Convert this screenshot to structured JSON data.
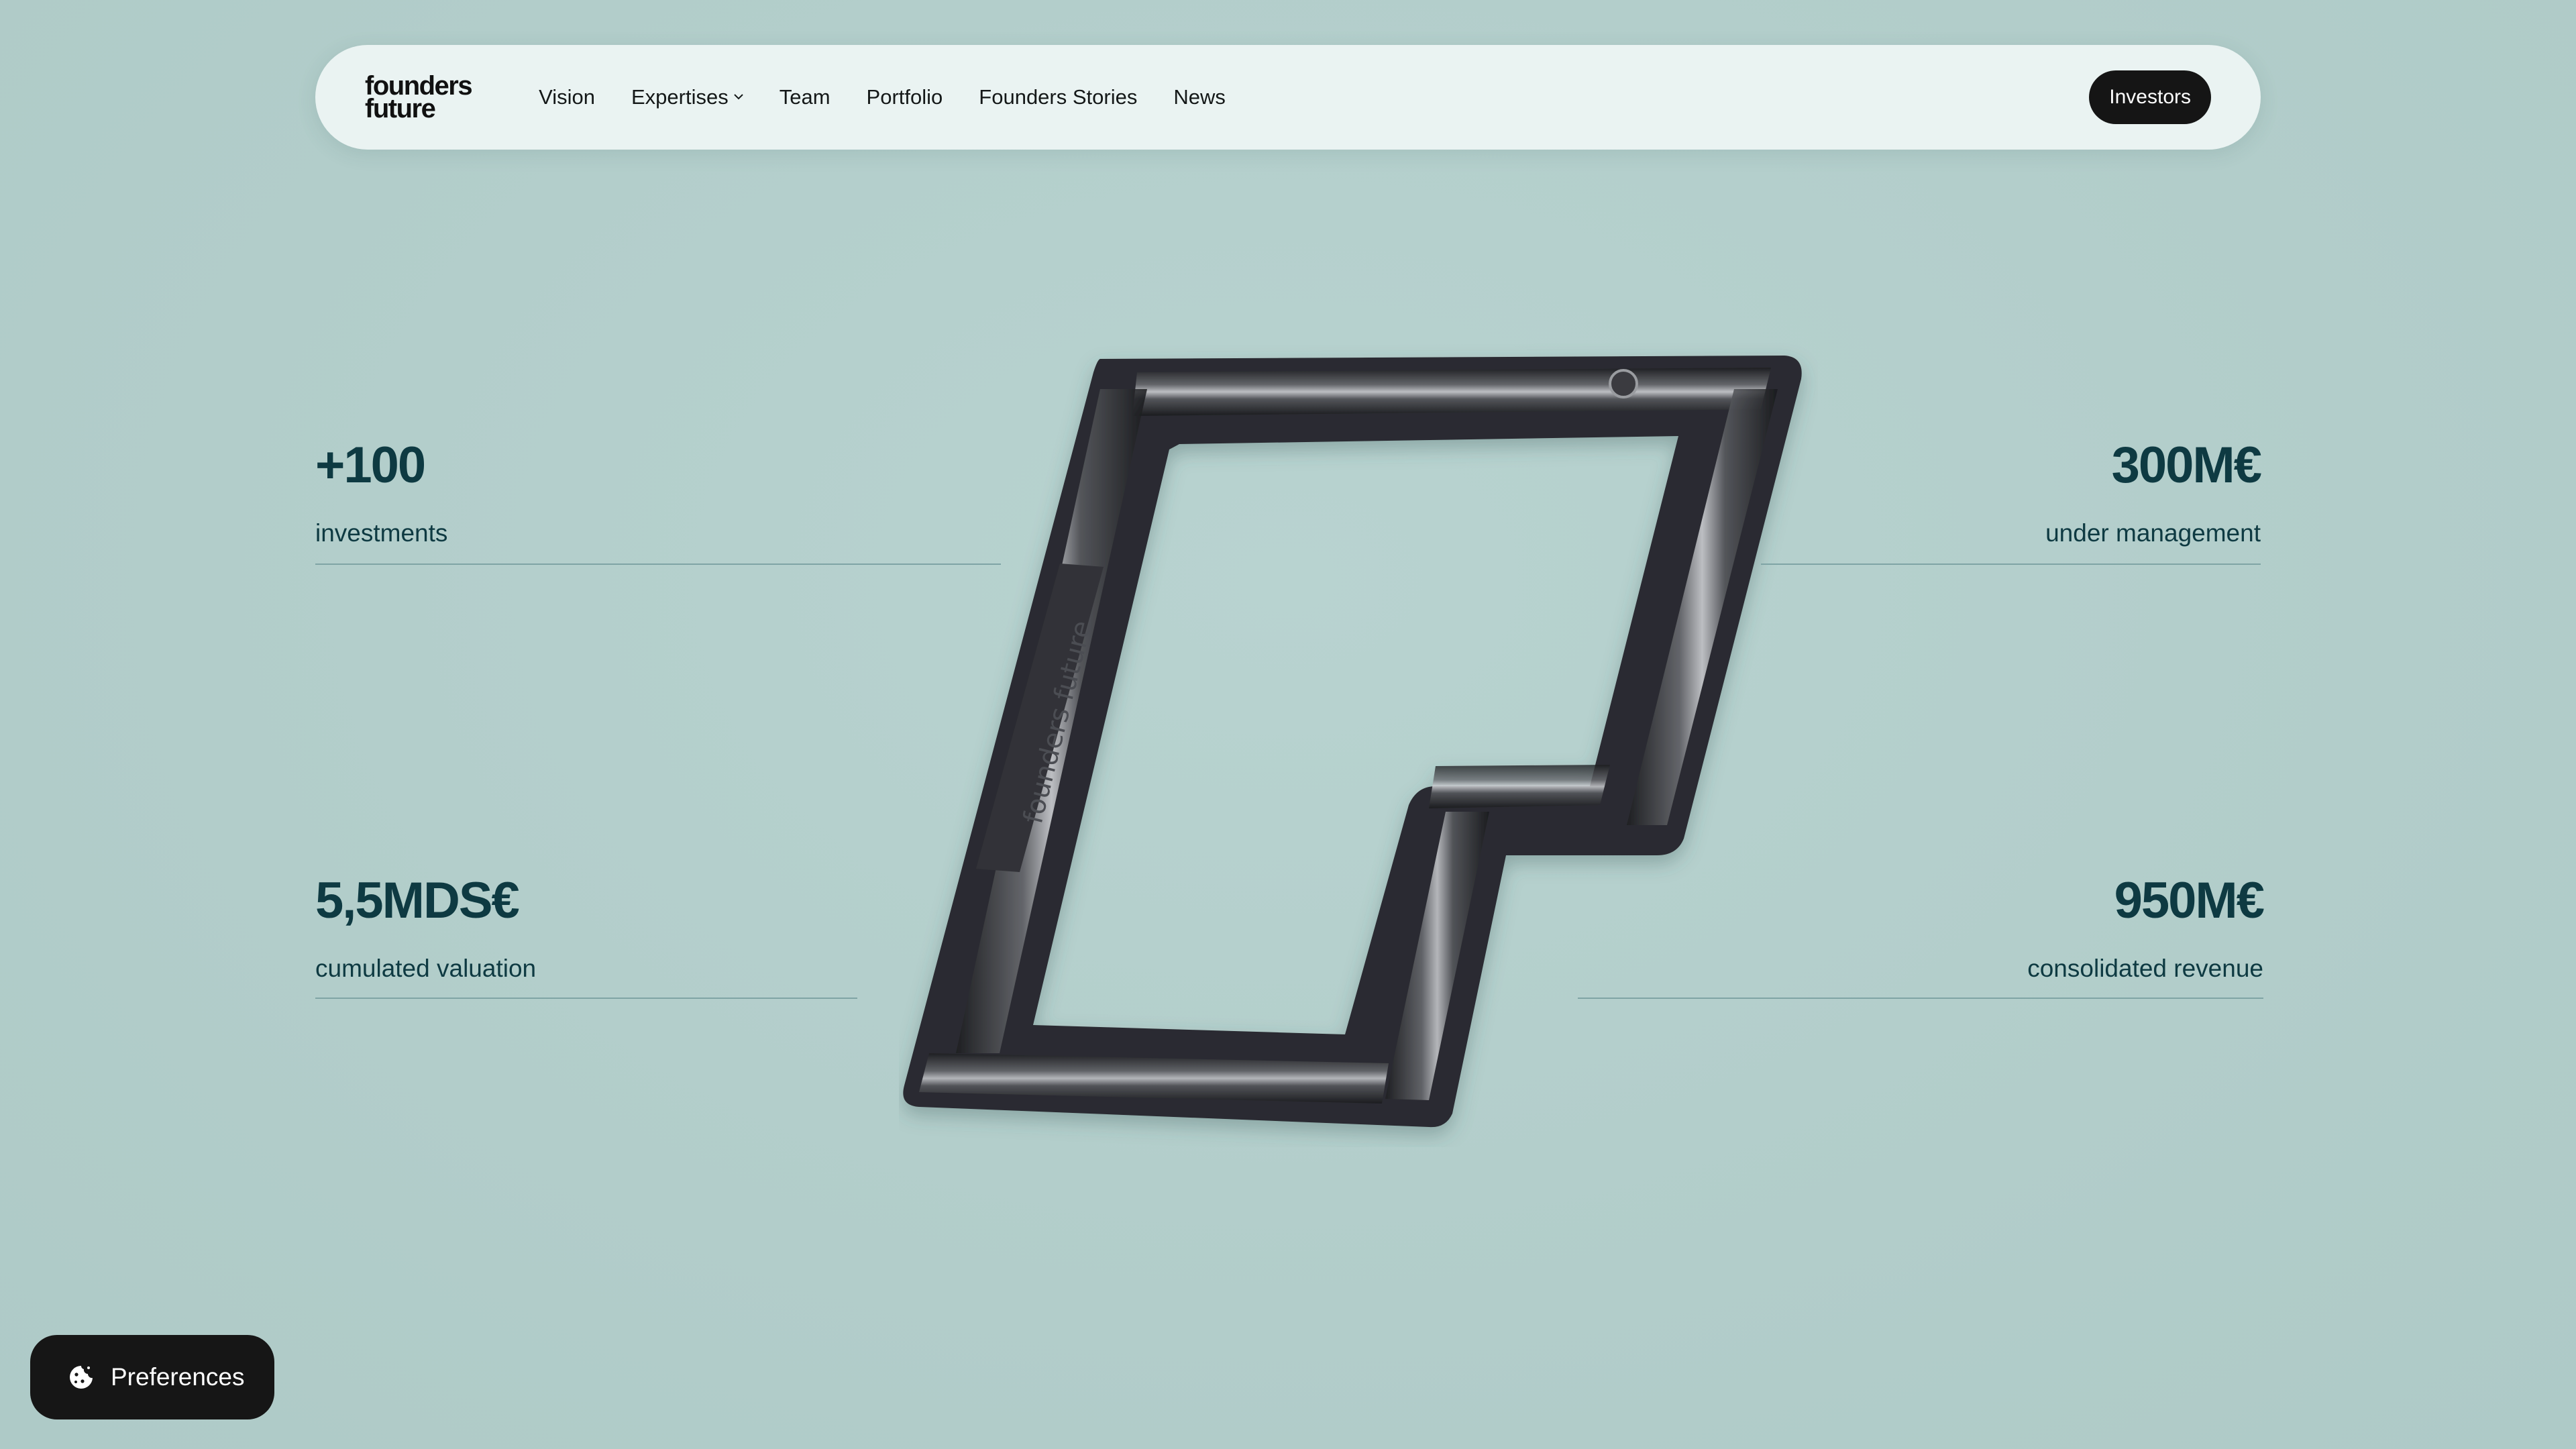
{
  "nav": {
    "logo_line1": "founders",
    "logo_line2": "future",
    "items": [
      {
        "label": "Vision"
      },
      {
        "label": "Expertises",
        "has_dropdown": true
      },
      {
        "label": "Team"
      },
      {
        "label": "Portfolio"
      },
      {
        "label": "Founders Stories"
      },
      {
        "label": "News"
      }
    ],
    "cta": "Investors"
  },
  "stats": [
    {
      "value": "+100",
      "label": "investments"
    },
    {
      "value": "300M€",
      "label": "under management"
    },
    {
      "value": "5,5MDS€",
      "label": "cumulated valuation"
    },
    {
      "value": "950M€",
      "label": "consolidated revenue"
    }
  ],
  "object": {
    "engraving": "founders future"
  },
  "preferences": {
    "label": "Preferences",
    "icon": "cookie-icon"
  },
  "colors": {
    "background": "#b3cfcc",
    "navbar": "#eaf3f2",
    "text_dark": "#0e3a42",
    "button": "#151515"
  }
}
